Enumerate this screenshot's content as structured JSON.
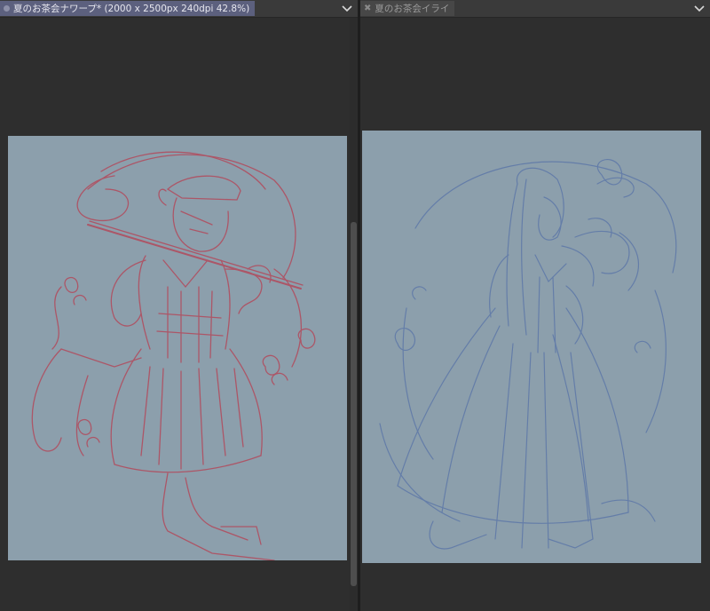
{
  "left_document": {
    "tab_title": "夏のお茶会ナワープ* (2000 x 2500px 240dpi 42.8%)",
    "tab_state": "active",
    "menu_icon": "chevron-down-icon",
    "canvas_color": "#8c9fac",
    "sketch_color": "#b24a5c"
  },
  "right_document": {
    "tab_title": "夏のお茶会イライ",
    "tab_state": "inactive",
    "close_icon": "close-icon",
    "menu_icon": "chevron-down-icon",
    "canvas_color": "#8c9fac",
    "sketch_color": "#5e78a8"
  }
}
